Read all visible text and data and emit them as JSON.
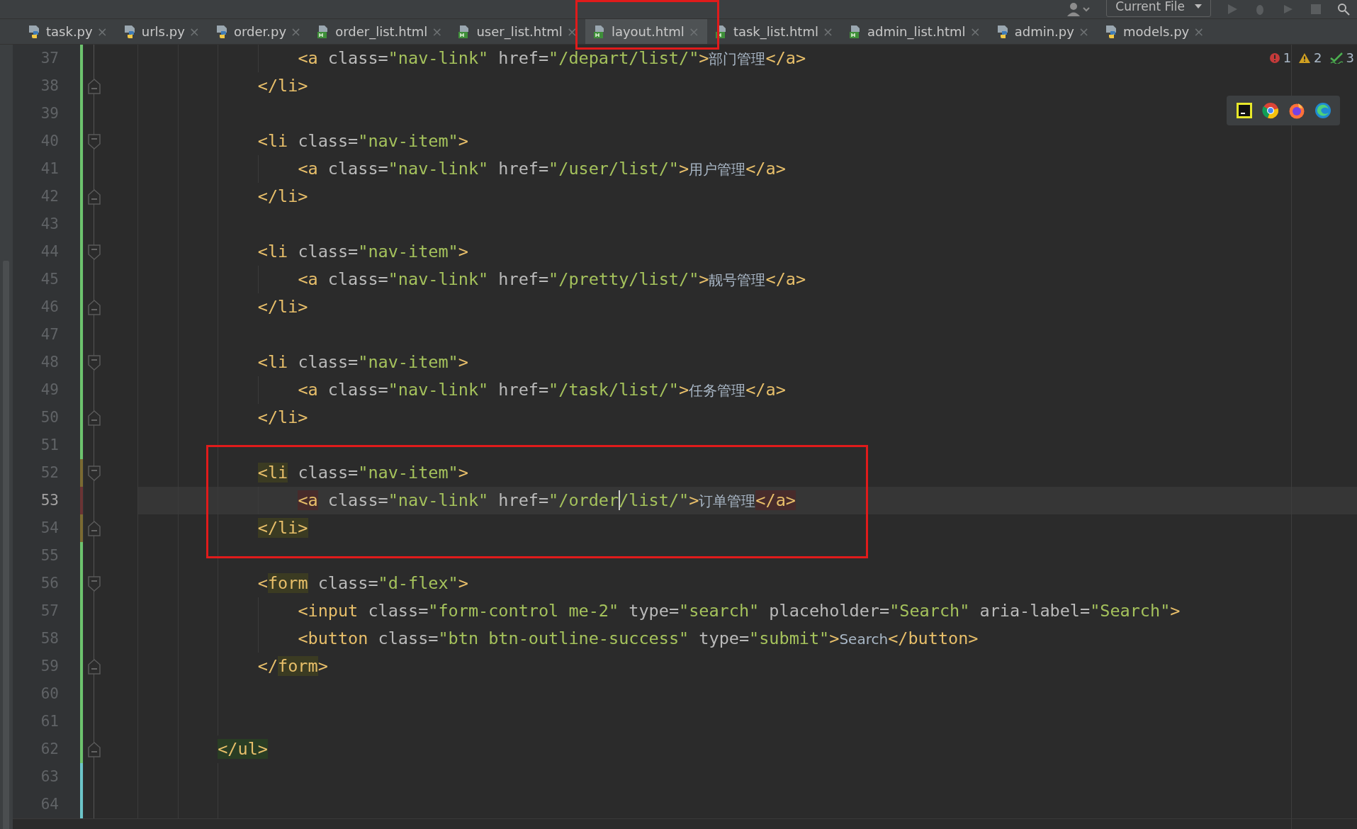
{
  "toolbar": {
    "run_config": "Current File"
  },
  "tabs": [
    {
      "label": "task.py",
      "kind": "python",
      "selected": false,
      "close": "×"
    },
    {
      "label": "urls.py",
      "kind": "python",
      "selected": false,
      "close": "×"
    },
    {
      "label": "order.py",
      "kind": "python",
      "selected": false,
      "close": "×"
    },
    {
      "label": "order_list.html",
      "kind": "html",
      "selected": false,
      "close": "×"
    },
    {
      "label": "user_list.html",
      "kind": "html",
      "selected": false,
      "close": "×"
    },
    {
      "label": "layout.html",
      "kind": "html",
      "selected": true,
      "close": "×"
    },
    {
      "label": "task_list.html",
      "kind": "html",
      "selected": false,
      "close": "×"
    },
    {
      "label": "admin_list.html",
      "kind": "html",
      "selected": false,
      "close": "×"
    },
    {
      "label": "admin.py",
      "kind": "python",
      "selected": false,
      "close": "×"
    },
    {
      "label": "models.py",
      "kind": "python",
      "selected": false,
      "close": "×"
    }
  ],
  "inspections": {
    "errors": "1",
    "warnings": "2",
    "typos": "3"
  },
  "editor": {
    "lines": [
      {
        "number": "37",
        "kind": "link",
        "color": "#6dc36d",
        "fold_start": false,
        "fold_end": false,
        "current": false,
        "tokens": [
          {
            "kind": "tag",
            "text": "<a"
          },
          {
            "kind": "attr",
            "text": " class="
          },
          {
            "kind": "value",
            "text": "\"nav-link\""
          },
          {
            "kind": "attr",
            "text": " href="
          },
          {
            "kind": "value",
            "text": "\"/depart/list/\""
          },
          {
            "kind": "tag",
            "text": ">"
          },
          {
            "kind": "text",
            "text": "部门管理"
          },
          {
            "kind": "tag",
            "text": "</a>"
          }
        ]
      },
      {
        "number": "38",
        "kind": "item",
        "color": "#6dc36d",
        "fold_start": false,
        "fold_end": true,
        "current": false,
        "tokens": [
          {
            "kind": "tag",
            "text": "</li>"
          }
        ]
      },
      {
        "number": "39",
        "kind": "blank",
        "color": "#6dc36d",
        "fold_start": false,
        "fold_end": false,
        "current": false
      },
      {
        "number": "40",
        "kind": "item",
        "color": "#6dc36d",
        "fold_start": true,
        "fold_end": false,
        "current": false,
        "tokens": [
          {
            "kind": "tag",
            "text": "<li"
          },
          {
            "kind": "attr",
            "text": " class="
          },
          {
            "kind": "value",
            "text": "\"nav-item\""
          },
          {
            "kind": "tag",
            "text": ">"
          }
        ]
      },
      {
        "number": "41",
        "kind": "link",
        "color": "#6dc36d",
        "fold_start": false,
        "fold_end": false,
        "current": false,
        "tokens": [
          {
            "kind": "tag",
            "text": "<a"
          },
          {
            "kind": "attr",
            "text": " class="
          },
          {
            "kind": "value",
            "text": "\"nav-link\""
          },
          {
            "kind": "attr",
            "text": " href="
          },
          {
            "kind": "value",
            "text": "\"/user/list/\""
          },
          {
            "kind": "tag",
            "text": ">"
          },
          {
            "kind": "text",
            "text": "用户管理"
          },
          {
            "kind": "tag",
            "text": "</a>"
          }
        ]
      },
      {
        "number": "42",
        "kind": "item",
        "color": "#6dc36d",
        "fold_start": false,
        "fold_end": true,
        "current": false,
        "tokens": [
          {
            "kind": "tag",
            "text": "</li>"
          }
        ]
      },
      {
        "number": "43",
        "kind": "blank",
        "color": "#6dc36d",
        "fold_start": false,
        "fold_end": false,
        "current": false
      },
      {
        "number": "44",
        "kind": "item",
        "color": "#6dc36d",
        "fold_start": true,
        "fold_end": false,
        "current": false,
        "tokens": [
          {
            "kind": "tag",
            "text": "<li"
          },
          {
            "kind": "attr",
            "text": " class="
          },
          {
            "kind": "value",
            "text": "\"nav-item\""
          },
          {
            "kind": "tag",
            "text": ">"
          }
        ]
      },
      {
        "number": "45",
        "kind": "link",
        "color": "#6dc36d",
        "fold_start": false,
        "fold_end": false,
        "current": false,
        "tokens": [
          {
            "kind": "tag",
            "text": "<a"
          },
          {
            "kind": "attr",
            "text": " class="
          },
          {
            "kind": "value",
            "text": "\"nav-link\""
          },
          {
            "kind": "attr",
            "text": " href="
          },
          {
            "kind": "value",
            "text": "\"/pretty/list/\""
          },
          {
            "kind": "tag",
            "text": ">"
          },
          {
            "kind": "text",
            "text": "靓号管理"
          },
          {
            "kind": "tag",
            "text": "</a>"
          }
        ]
      },
      {
        "number": "46",
        "kind": "item",
        "color": "#6dc36d",
        "fold_start": false,
        "fold_end": true,
        "current": false,
        "tokens": [
          {
            "kind": "tag",
            "text": "</li>"
          }
        ]
      },
      {
        "number": "47",
        "kind": "blank",
        "color": "#6dc36d",
        "fold_start": false,
        "fold_end": false,
        "current": false
      },
      {
        "number": "48",
        "kind": "item",
        "color": "#6dc36d",
        "fold_start": true,
        "fold_end": false,
        "current": false,
        "tokens": [
          {
            "kind": "tag",
            "text": "<li"
          },
          {
            "kind": "attr",
            "text": " class="
          },
          {
            "kind": "value",
            "text": "\"nav-item\""
          },
          {
            "kind": "tag",
            "text": ">"
          }
        ]
      },
      {
        "number": "49",
        "kind": "link",
        "color": "#6dc36d",
        "fold_start": false,
        "fold_end": false,
        "current": false,
        "tokens": [
          {
            "kind": "tag",
            "text": "<a"
          },
          {
            "kind": "attr",
            "text": " class="
          },
          {
            "kind": "value",
            "text": "\"nav-link\""
          },
          {
            "kind": "attr",
            "text": " href="
          },
          {
            "kind": "value",
            "text": "\"/task/list/\""
          },
          {
            "kind": "tag",
            "text": ">"
          },
          {
            "kind": "text",
            "text": "任务管理"
          },
          {
            "kind": "tag",
            "text": "</a>"
          }
        ]
      },
      {
        "number": "50",
        "kind": "item",
        "color": "#6dc36d",
        "fold_start": false,
        "fold_end": true,
        "current": false,
        "tokens": [
          {
            "kind": "tag",
            "text": "</li>"
          }
        ]
      },
      {
        "number": "51",
        "kind": "blank",
        "color": "#6dc36d",
        "fold_start": false,
        "fold_end": false,
        "current": false
      },
      {
        "number": "52",
        "kind": "item",
        "color": "#7b6a32",
        "fold_start": true,
        "fold_end": false,
        "current": false,
        "tokens": [
          {
            "kind": "tag",
            "text": "<li",
            "color": "#3b3b22"
          },
          {
            "kind": "attr",
            "text": " class="
          },
          {
            "kind": "value",
            "text": "\"nav-item\""
          },
          {
            "kind": "tag",
            "text": ">"
          }
        ]
      },
      {
        "number": "53",
        "kind": "link",
        "color": "#6b3434",
        "fold_start": false,
        "fold_end": false,
        "current": true,
        "tokens": [
          {
            "kind": "tag",
            "text": "<a",
            "color": "#472b2b"
          },
          {
            "kind": "attr",
            "text": " class="
          },
          {
            "kind": "value",
            "text": "\"nav-link\""
          },
          {
            "kind": "attr",
            "text": " href="
          },
          {
            "kind": "value",
            "text": "\"/order"
          },
          {
            "kind": "caret"
          },
          {
            "kind": "value",
            "text": "/list/\""
          },
          {
            "kind": "tag",
            "text": ">"
          },
          {
            "kind": "text",
            "text": "订单管理"
          },
          {
            "kind": "tag",
            "text": "</a>",
            "color": "#472b2b"
          }
        ]
      },
      {
        "number": "54",
        "kind": "item",
        "color": "#7b6a32",
        "fold_start": false,
        "fold_end": true,
        "current": false,
        "tokens": [
          {
            "kind": "tag",
            "text": "</li>",
            "color": "#3b3b22"
          }
        ]
      },
      {
        "number": "55",
        "kind": "blank",
        "color": "#6dc36d",
        "fold_start": false,
        "fold_end": false,
        "current": false
      },
      {
        "number": "56",
        "kind": "item",
        "color": "#6dc36d",
        "fold_start": true,
        "fold_end": false,
        "current": false,
        "tokens": [
          {
            "kind": "tag",
            "text": "<"
          },
          {
            "kind": "tag",
            "text": "form",
            "color": "#3b3b22"
          },
          {
            "kind": "attr",
            "text": " class="
          },
          {
            "kind": "value",
            "text": "\"d-flex\""
          },
          {
            "kind": "tag",
            "text": ">"
          }
        ]
      },
      {
        "number": "57",
        "kind": "link",
        "color": "#6dc36d",
        "fold_start": false,
        "fold_end": false,
        "current": false,
        "tokens": [
          {
            "kind": "tag",
            "text": "<input"
          },
          {
            "kind": "attr",
            "text": " class="
          },
          {
            "kind": "value",
            "text": "\"form-control me-2\""
          },
          {
            "kind": "attr",
            "text": " type="
          },
          {
            "kind": "value",
            "text": "\"search\""
          },
          {
            "kind": "attr",
            "text": " placeholder="
          },
          {
            "kind": "value",
            "text": "\"Search\""
          },
          {
            "kind": "attr",
            "text": " aria-label="
          },
          {
            "kind": "value",
            "text": "\"Search\""
          },
          {
            "kind": "tag",
            "text": ">"
          }
        ]
      },
      {
        "number": "58",
        "kind": "link",
        "color": "#6dc36d",
        "fold_start": false,
        "fold_end": false,
        "current": false,
        "tokens": [
          {
            "kind": "tag",
            "text": "<button"
          },
          {
            "kind": "attr",
            "text": " class="
          },
          {
            "kind": "value",
            "text": "\"btn btn-outline-success\""
          },
          {
            "kind": "attr",
            "text": " type="
          },
          {
            "kind": "value",
            "text": "\"submit\""
          },
          {
            "kind": "tag",
            "text": ">"
          },
          {
            "kind": "text",
            "text": "Search"
          },
          {
            "kind": "tag",
            "text": "</button>"
          }
        ]
      },
      {
        "number": "59",
        "kind": "item",
        "color": "#6dc36d",
        "fold_start": false,
        "fold_end": true,
        "current": false,
        "tokens": [
          {
            "kind": "tag",
            "text": "</"
          },
          {
            "kind": "tag",
            "text": "form",
            "color": "#3b3b22"
          },
          {
            "kind": "tag",
            "text": ">"
          }
        ]
      },
      {
        "number": "60",
        "kind": "blank",
        "color": "#6dc36d",
        "fold_start": false,
        "fold_end": false,
        "current": false
      },
      {
        "number": "61",
        "kind": "blank",
        "color": "#6dc36d",
        "fold_start": false,
        "fold_end": false,
        "current": false
      },
      {
        "number": "62",
        "kind": "list",
        "color": "#6dc36d",
        "fold_start": false,
        "fold_end": true,
        "current": false,
        "tokens": [
          {
            "kind": "tag",
            "text": "</ul>",
            "color": "#293d24"
          }
        ]
      },
      {
        "number": "63",
        "kind": "blank",
        "color": "#6cc5c9",
        "fold_start": false,
        "fold_end": false,
        "current": false
      },
      {
        "number": "64",
        "kind": "blank",
        "color": "#6cc5c9",
        "fold_start": false,
        "fold_end": false,
        "current": false
      }
    ]
  }
}
